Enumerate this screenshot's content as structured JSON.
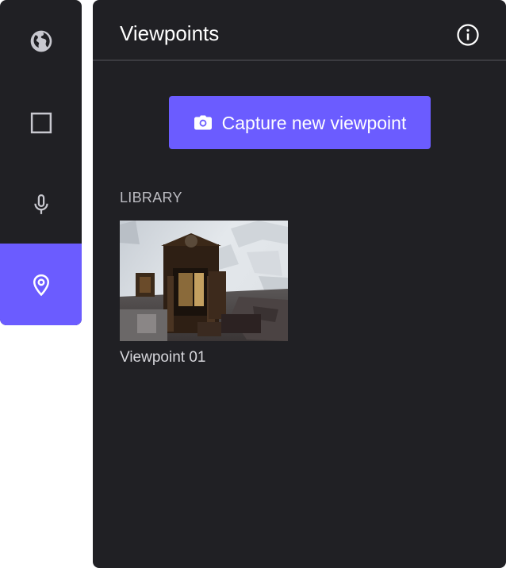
{
  "nav_rail": {
    "items": [
      {
        "icon": "globe-icon",
        "active": false
      },
      {
        "icon": "square-icon",
        "active": false
      },
      {
        "icon": "microphone-icon",
        "active": false
      },
      {
        "icon": "location-pin-icon",
        "active": true
      }
    ]
  },
  "panel": {
    "title": "Viewpoints",
    "info_icon": "info-icon",
    "capture_button": {
      "icon": "camera-icon",
      "label": "Capture new viewpoint"
    },
    "library": {
      "section_label": "LIBRARY",
      "items": [
        {
          "label": "Viewpoint 01"
        }
      ]
    }
  },
  "colors": {
    "background": "#202024",
    "accent": "#6b5cff",
    "divider": "#3b3b40",
    "muted_text": "#bdbdc3"
  }
}
